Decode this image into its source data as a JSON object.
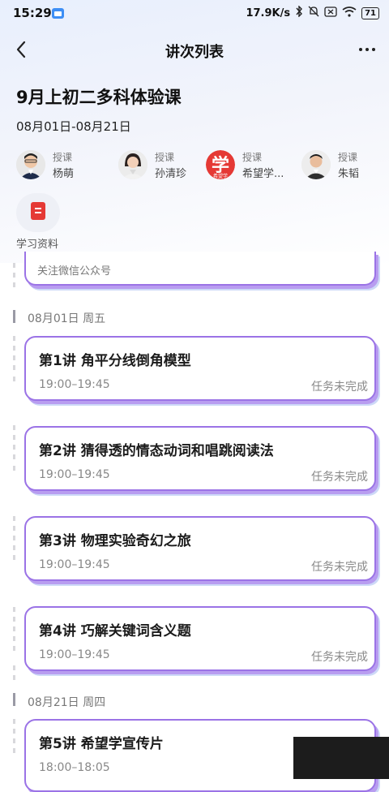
{
  "status_bar": {
    "time": "15:29",
    "network_speed": "17.9K/s",
    "battery": "71",
    "icons": [
      "app-icon",
      "bluetooth-icon",
      "mute-icon",
      "sim-icon",
      "wifi-icon",
      "battery-icon"
    ]
  },
  "nav": {
    "title": "讲次列表",
    "back_icon": "chevron-left-icon",
    "more_icon": "more-dots-icon"
  },
  "course": {
    "title": "9月上初二多科体验课",
    "dates": "08月01日-08月21日"
  },
  "teachers": [
    {
      "role": "授课",
      "name": "杨萌",
      "avatar": "avatar-photo"
    },
    {
      "role": "授课",
      "name": "孙清珍",
      "avatar": "avatar-photo"
    },
    {
      "role": "授课",
      "name": "希望学...",
      "avatar": "xiwangxue-logo",
      "logo_char": "学",
      "logo_sub": "希望学"
    },
    {
      "role": "授课",
      "name": "朱韬",
      "avatar": "avatar-photo"
    }
  ],
  "materials": {
    "label": "学习资料",
    "icon": "document-icon"
  },
  "partial_card": {
    "text": "关注微信公众号"
  },
  "groups": [
    {
      "date": "08月01日  周五",
      "lessons": [
        {
          "title": "第1讲 角平分线倒角模型",
          "time": "19:00–19:45",
          "status": "任务未完成"
        },
        {
          "title": "第2讲 猜得透的情态动词和唱跳阅读法",
          "time": "19:00–19:45",
          "status": "任务未完成"
        },
        {
          "title": "第3讲 物理实验奇幻之旅",
          "time": "19:00–19:45",
          "status": "任务未完成"
        },
        {
          "title": "第4讲 巧解关键词含义题",
          "time": "19:00–19:45",
          "status": "任务未完成"
        }
      ]
    },
    {
      "date": "08月21日  周四",
      "lessons": [
        {
          "title": "第5讲 希望学宣传片",
          "time": "18:00–18:05",
          "status": ""
        }
      ]
    }
  ],
  "colors": {
    "card_border": "#9b73e6",
    "logo_red": "#e53935",
    "muted_text": "#888888"
  }
}
